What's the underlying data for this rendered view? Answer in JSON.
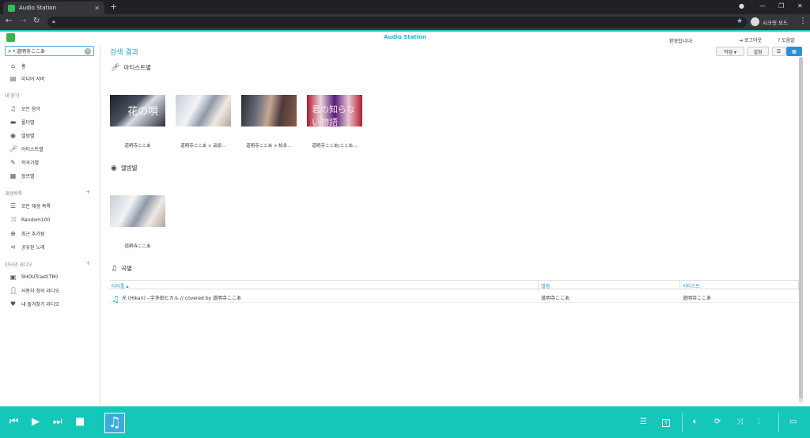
{
  "browser": {
    "tab_title": "Audio Station",
    "new_tab": "+",
    "incognito_label": "시크릿 모드"
  },
  "app": {
    "title": "Audio Station",
    "welcome": "환영합니다!",
    "logout": "로그아웃",
    "help": "도움말"
  },
  "sidebar": {
    "search_value": "道明寺ここあ",
    "items": [
      {
        "label": "홈",
        "icon": "home-icon"
      },
      {
        "label": "미디어 서버",
        "icon": "media-server-icon"
      }
    ],
    "my_music_header": "내 음악",
    "my_music": [
      {
        "label": "모든 음악",
        "icon": "music-note-icon"
      },
      {
        "label": "폴더별",
        "icon": "folder-icon"
      },
      {
        "label": "앨범별",
        "icon": "disc-icon"
      },
      {
        "label": "아티스트별",
        "icon": "microphone-icon"
      },
      {
        "label": "작곡가별",
        "icon": "pen-icon"
      },
      {
        "label": "장르별",
        "icon": "grid-icon"
      }
    ],
    "playlist_header": "재생목록",
    "playlists": [
      {
        "label": "모든 재생 목록",
        "icon": "playlist-icon"
      },
      {
        "label": "Random100",
        "icon": "shuffle-icon"
      },
      {
        "label": "최근 추가됨",
        "icon": "add-circle-icon"
      },
      {
        "label": "공유된 노래",
        "icon": "share-icon"
      }
    ],
    "radio_header": "인터넷 라디오",
    "radios": [
      {
        "label": "SHOUTcast(TM)",
        "icon": "radio-icon"
      },
      {
        "label": "사용자 정의 라디오",
        "icon": "user-icon"
      },
      {
        "label": "내 즐겨찾기 라디오",
        "icon": "heart-icon"
      }
    ]
  },
  "main": {
    "heading": "검색 결과",
    "action_btn": "작업 ▾",
    "settings_btn": "설정",
    "artists_title": "아티스트별",
    "artists": [
      {
        "caption": "道明寺ここあ"
      },
      {
        "caption": "道明寺ここあ × 凪原…"
      },
      {
        "caption": "道明寺ここあ × 松永…"
      },
      {
        "caption": "道明寺ここあ[ここあ…"
      }
    ],
    "albums_title": "앨범별",
    "albums": [
      {
        "caption": "道明寺ここあ"
      }
    ],
    "songs_title": "곡별",
    "columns": {
      "title": "타이틀 ▴",
      "album": "앨범",
      "artist": "아티스트"
    },
    "songs": [
      {
        "title": "光 (Hikari) - 宇多田ヒカル // covered by 道明寺ここあ",
        "album": "道明寺ここあ",
        "artist": "道明寺ここあ"
      }
    ]
  }
}
